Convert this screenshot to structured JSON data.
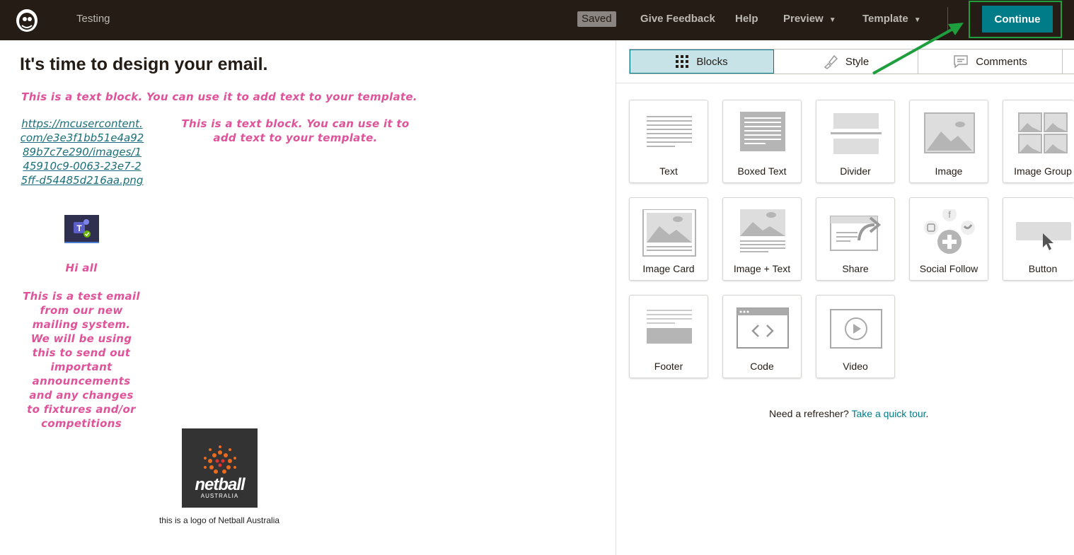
{
  "topbar": {
    "campaign_name": "Testing",
    "saved": "Saved",
    "give_feedback": "Give Feedback",
    "help": "Help",
    "preview": "Preview",
    "template": "Template",
    "continue": "Continue"
  },
  "editor": {
    "heading": "It's time to design your email.",
    "text_block_1": "This is a text block. You can use it to add text to your template.",
    "text_block_2": "This is a text block. You can use it to add text to your template.",
    "image_link": "https://mcusercontent.com/e3e3f1bb51e4a9289b7c7e290/images/145910c9-0063-23e7-25ff-d54485d216aa.png",
    "greeting": "Hi all",
    "body": "This is a test email from our new mailing system. We will be using this to send out important announcements and any changes to fixtures and/or competitions",
    "logo_word": "netball",
    "logo_sub": "AUSTRALIA",
    "caption": "this is a logo of Netball Australia"
  },
  "panel": {
    "tabs": [
      "Blocks",
      "Style",
      "Comments"
    ],
    "blocks": [
      "Text",
      "Boxed Text",
      "Divider",
      "Image",
      "Image Group",
      "Image Card",
      "Image + Text",
      "Share",
      "Social Follow",
      "Button",
      "Footer",
      "Code",
      "Video"
    ],
    "refresher_text": "Need a refresher?",
    "refresher_link": "Take a quick tour"
  },
  "colors": {
    "topbar": "#241c15",
    "accent": "#007c89",
    "pink_text": "#e0539a",
    "highlight": "#1e9e3c"
  }
}
